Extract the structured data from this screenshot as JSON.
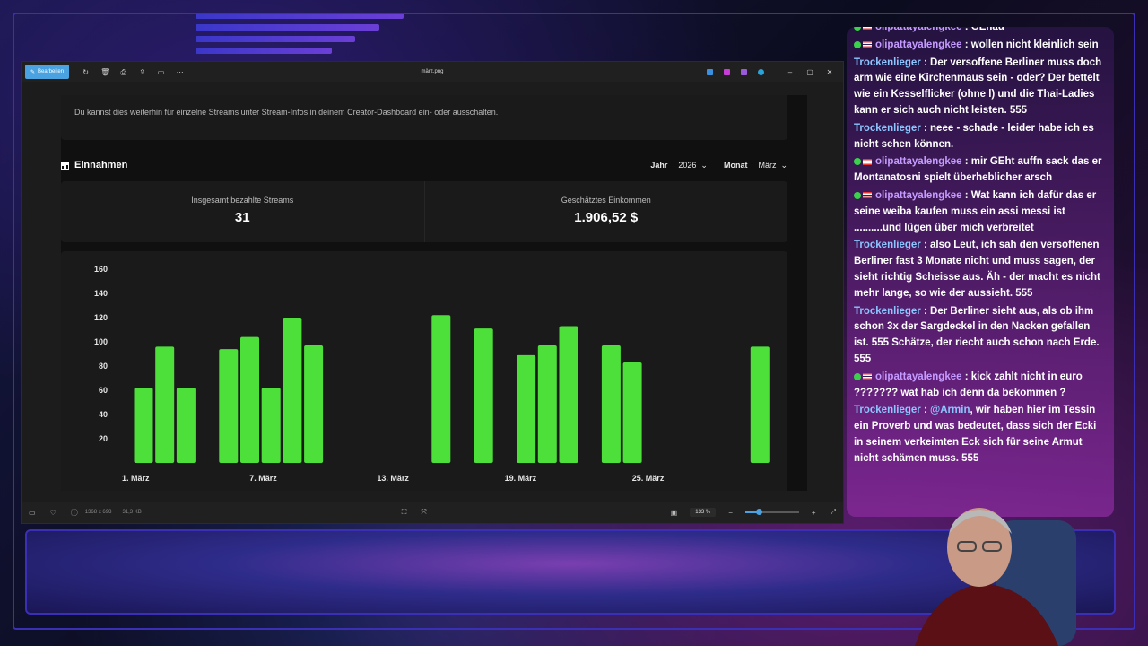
{
  "viewer": {
    "edit_label": "Bearbeiten",
    "filename": "märz.png",
    "status_dimensions": "1368 x 693",
    "status_size": "31,3 KB",
    "zoom": "133 %",
    "zoom_level": 0.25,
    "app_icon_colors": [
      "#3b8fe0",
      "#c73bd6",
      "#9a5bd9",
      "#2aa3d8"
    ]
  },
  "dashboard": {
    "note": "Du kannst dies weiterhin für einzelne Streams unter Stream-Infos in deinem Creator-Dashboard ein- oder ausschalten.",
    "section_title": "Einnahmen",
    "year_label": "Jahr",
    "year_value": "2026",
    "month_label": "Monat",
    "month_value": "März",
    "stats": [
      {
        "label": "Insgesamt bezahlte Streams",
        "value": "31"
      },
      {
        "label": "Geschätztes Einkommen",
        "value": "1.906,52 $"
      }
    ],
    "accent": "#4ee03a"
  },
  "chart_data": {
    "type": "bar",
    "ylim": [
      0,
      160
    ],
    "yticks": [
      20,
      40,
      60,
      80,
      100,
      120,
      140,
      160
    ],
    "x_tick_labels": [
      {
        "day": 1,
        "label": "1. März"
      },
      {
        "day": 7,
        "label": "7. März"
      },
      {
        "day": 13,
        "label": "13. März"
      },
      {
        "day": 19,
        "label": "19. März"
      },
      {
        "day": 25,
        "label": "25. März"
      }
    ],
    "days": [
      1,
      2,
      3,
      4,
      5,
      6,
      7,
      8,
      9,
      10,
      11,
      12,
      13,
      14,
      15,
      16,
      17,
      18,
      19,
      20,
      21,
      22,
      23,
      24,
      25,
      26,
      27,
      28,
      29,
      30,
      31
    ],
    "values": [
      62,
      96,
      62,
      0,
      94,
      104,
      62,
      120,
      97,
      0,
      0,
      0,
      0,
      0,
      122,
      0,
      111,
      0,
      89,
      97,
      113,
      0,
      97,
      83,
      0,
      0,
      0,
      0,
      0,
      96,
      0
    ]
  },
  "chat": [
    {
      "user": "olipattayalengkee",
      "badge": true,
      "text": "GEnau"
    },
    {
      "user": "olipattayalengkee",
      "badge": true,
      "text": "wollen nicht kleinlich sein"
    },
    {
      "user": "Trockenlieger",
      "badge": false,
      "text": "Der versoffene Berliner muss doch arm wie eine Kirchenmaus sein - oder? Der bettelt wie ein Kesselflicker (ohne l) und die Thai-Ladies kann er sich auch nicht leisten. 555"
    },
    {
      "user": "Trockenlieger",
      "badge": false,
      "text": "neee - schade - leider habe ich es nicht sehen können."
    },
    {
      "user": "olipattayalengkee",
      "badge": true,
      "text": "mir GEht auffn sack das er Montanatosni spielt überheblicher arsch"
    },
    {
      "user": "olipattayalengkee",
      "badge": true,
      "text": "Wat kann ich dafür das er seine weiba kaufen muss ein assi messi ist ..........und lügen über mich verbreitet"
    },
    {
      "user": "Trockenlieger",
      "badge": false,
      "text": "also Leut, ich sah den versoffenen Berliner fast 3 Monate nicht und muss sagen, der sieht richtig Scheisse aus. Äh - der macht es nicht mehr lange, so wie der aussieht. 555"
    },
    {
      "user": "Trockenlieger",
      "badge": false,
      "text": "Der Berliner sieht aus, als ob ihm schon 3x der Sargdeckel in den Nacken gefallen ist. 555 Schätze, der riecht auch schon nach Erde. 555"
    },
    {
      "user": "olipattayalengkee",
      "badge": true,
      "text": "kick zahlt nicht in euro ??????? wat hab ich denn da bekommen ?"
    },
    {
      "user": "Trockenlieger",
      "badge": false,
      "mention": "@Armin",
      "text": ", wir haben hier im Tessin ein Proverb und was bedeutet, dass sich der Ecki in seinem verkeimten Eck sich für seine Armut nicht schämen muss. 555"
    }
  ]
}
